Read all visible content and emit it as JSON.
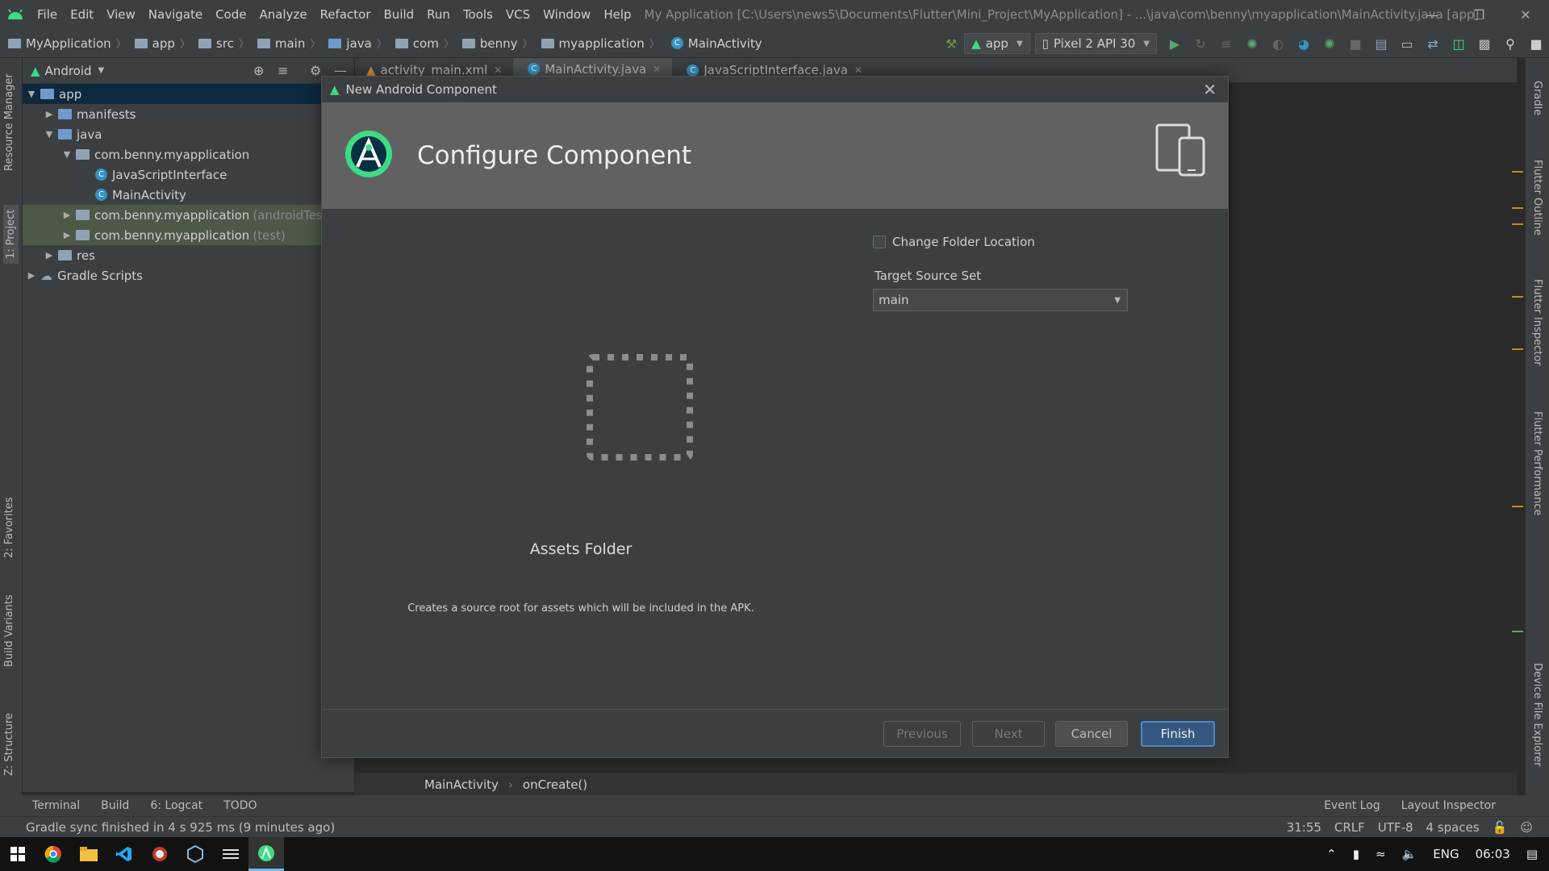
{
  "menu": [
    "File",
    "Edit",
    "View",
    "Navigate",
    "Code",
    "Analyze",
    "Refactor",
    "Build",
    "Run",
    "Tools",
    "VCS",
    "Window",
    "Help"
  ],
  "window_title": "My Application [C:\\Users\\news5\\Documents\\Flutter\\Mini_Project\\MyApplication] - ...\\java\\com\\benny\\myapplication\\MainActivity.java [app]",
  "breadcrumbs": [
    "MyApplication",
    "app",
    "src",
    "main",
    "java",
    "com",
    "benny",
    "myapplication",
    "MainActivity"
  ],
  "run_config": "app",
  "device": "Pixel 2 API 30",
  "project_panel": {
    "view": "Android",
    "tree": {
      "app": "app",
      "manifests": "manifests",
      "java": "java",
      "pkg_main": "com.benny.myapplication",
      "js_interface": "JavaScriptInterface",
      "main_activity": "MainActivity",
      "pkg_android_test": "com.benny.myapplication",
      "pkg_android_test_suffix": "(androidTest)",
      "pkg_test": "com.benny.myapplication",
      "pkg_test_suffix": "(test)",
      "res": "res",
      "gradle": "Gradle Scripts"
    }
  },
  "left_tools": [
    "Resource Manager",
    "1: Project",
    "2: Favorites",
    "Build Variants",
    "Z: Structure"
  ],
  "right_tools": [
    "Gradle",
    "Flutter Outline",
    "Flutter Inspector",
    "Flutter Performance",
    "Device File Explorer"
  ],
  "editor_tabs": [
    "activity_main.xml",
    "MainActivity.java",
    "JavaScriptInterface.java"
  ],
  "editor_breadcrumb": [
    "MainActivity",
    "onCreate()"
  ],
  "dialog": {
    "window_title": "New Android Component",
    "header": "Configure Component",
    "change_folder_label": "Change Folder Location",
    "target_label": "Target Source Set",
    "target_value": "main",
    "component_name": "Assets Folder",
    "description": "Creates a source root for assets which will be included in the APK.",
    "buttons": {
      "previous": "Previous",
      "next": "Next",
      "cancel": "Cancel",
      "finish": "Finish"
    }
  },
  "bottom_tools": {
    "terminal": "Terminal",
    "build": "Build",
    "logcat": "6: Logcat",
    "todo": "TODO",
    "event_log": "Event Log",
    "layout_inspector": "Layout Inspector"
  },
  "status": {
    "message": "Gradle sync finished in 4 s 925 ms (9 minutes ago)",
    "position": "31:55",
    "line_sep": "CRLF",
    "encoding": "UTF-8",
    "indent": "4 spaces"
  },
  "taskbar": {
    "lang": "ENG",
    "time": "06:03"
  },
  "colors": {
    "accent": "#4a88c7",
    "android_green": "#3ddc84",
    "selection": "#0d293e"
  }
}
